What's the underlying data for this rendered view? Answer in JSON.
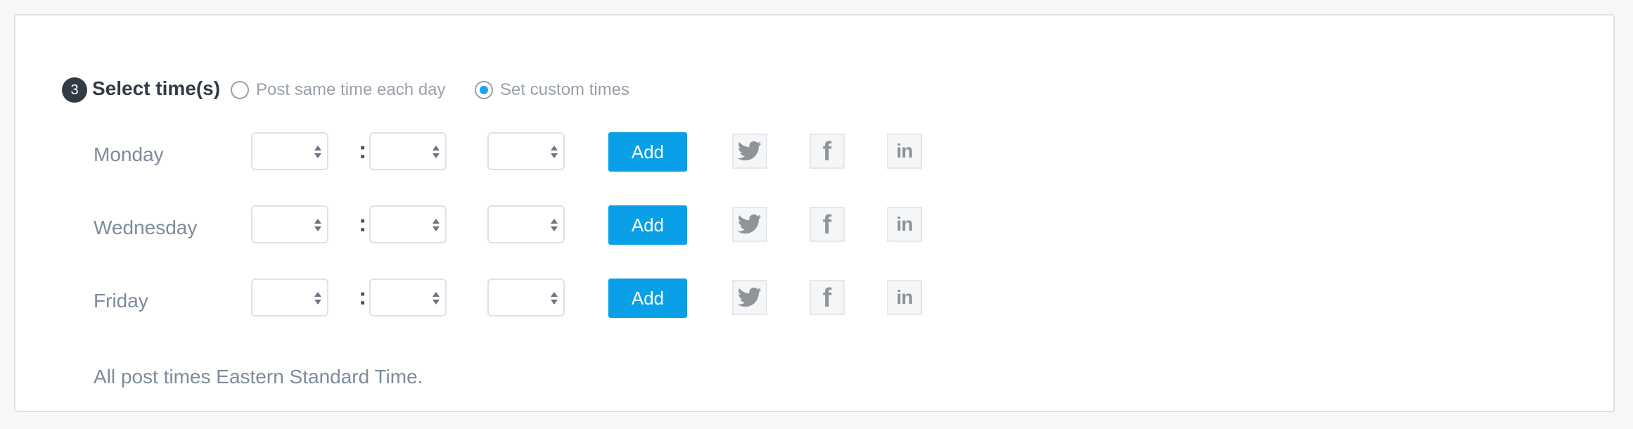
{
  "section": {
    "step_number": "3",
    "title": "Select time(s)"
  },
  "options": [
    {
      "label": "Post same time each day",
      "checked": false
    },
    {
      "label": "Set custom times",
      "checked": true
    }
  ],
  "days": [
    {
      "label": "Monday",
      "add_label": "Add"
    },
    {
      "label": "Wednesday",
      "add_label": "Add"
    },
    {
      "label": "Friday",
      "add_label": "Add"
    }
  ],
  "time_separator": ":",
  "social_icons": [
    "twitter-icon",
    "facebook-icon",
    "linkedin-icon"
  ],
  "social_glyphs": {
    "facebook": "f",
    "linkedin": "in"
  },
  "note": "All post times Eastern Standard Time.",
  "colors": {
    "accent": "#0aa0e8",
    "title": "#323a46",
    "muted": "#7f8a9c"
  }
}
